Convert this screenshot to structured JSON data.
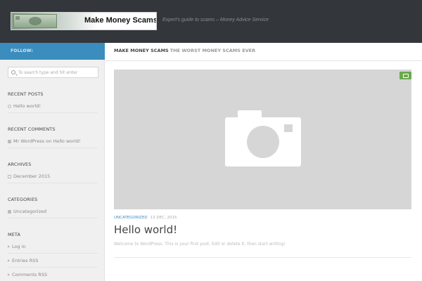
{
  "header": {
    "logo_text": "Make Money Scams",
    "tagline": "Expert's guide to scams – Money Advice Service"
  },
  "sidebar": {
    "follow_label": "FOLLOW:",
    "search_placeholder": "To search type and hit enter",
    "recent_posts": {
      "title": "RECENT POSTS",
      "items": [
        "Hello world!"
      ]
    },
    "recent_comments": {
      "title": "RECENT COMMENTS",
      "author": "Mr WordPress",
      "on": "on",
      "post": "Hello world!"
    },
    "archives": {
      "title": "ARCHIVES",
      "items": [
        "December 2015"
      ]
    },
    "categories": {
      "title": "CATEGORIES",
      "items": [
        "Uncategorized"
      ]
    },
    "meta": {
      "title": "META",
      "items": [
        "Log in",
        "Entries RSS",
        "Comments RSS"
      ]
    }
  },
  "main": {
    "breadcrumb_site": "MAKE MONEY SCAMS",
    "breadcrumb_desc": "THE WORST MONEY SCAMS EVER",
    "post": {
      "category": "UNCATEGORIZED",
      "date": "13 DEC, 2015",
      "title": "Hello world!",
      "excerpt": "Welcome to WordPress. This is your first post. Edit or delete it, then start writing!"
    }
  },
  "colors": {
    "header_bg": "#33363b",
    "accent_blue": "#3b8dbd",
    "comment_green": "#6aa84f"
  }
}
